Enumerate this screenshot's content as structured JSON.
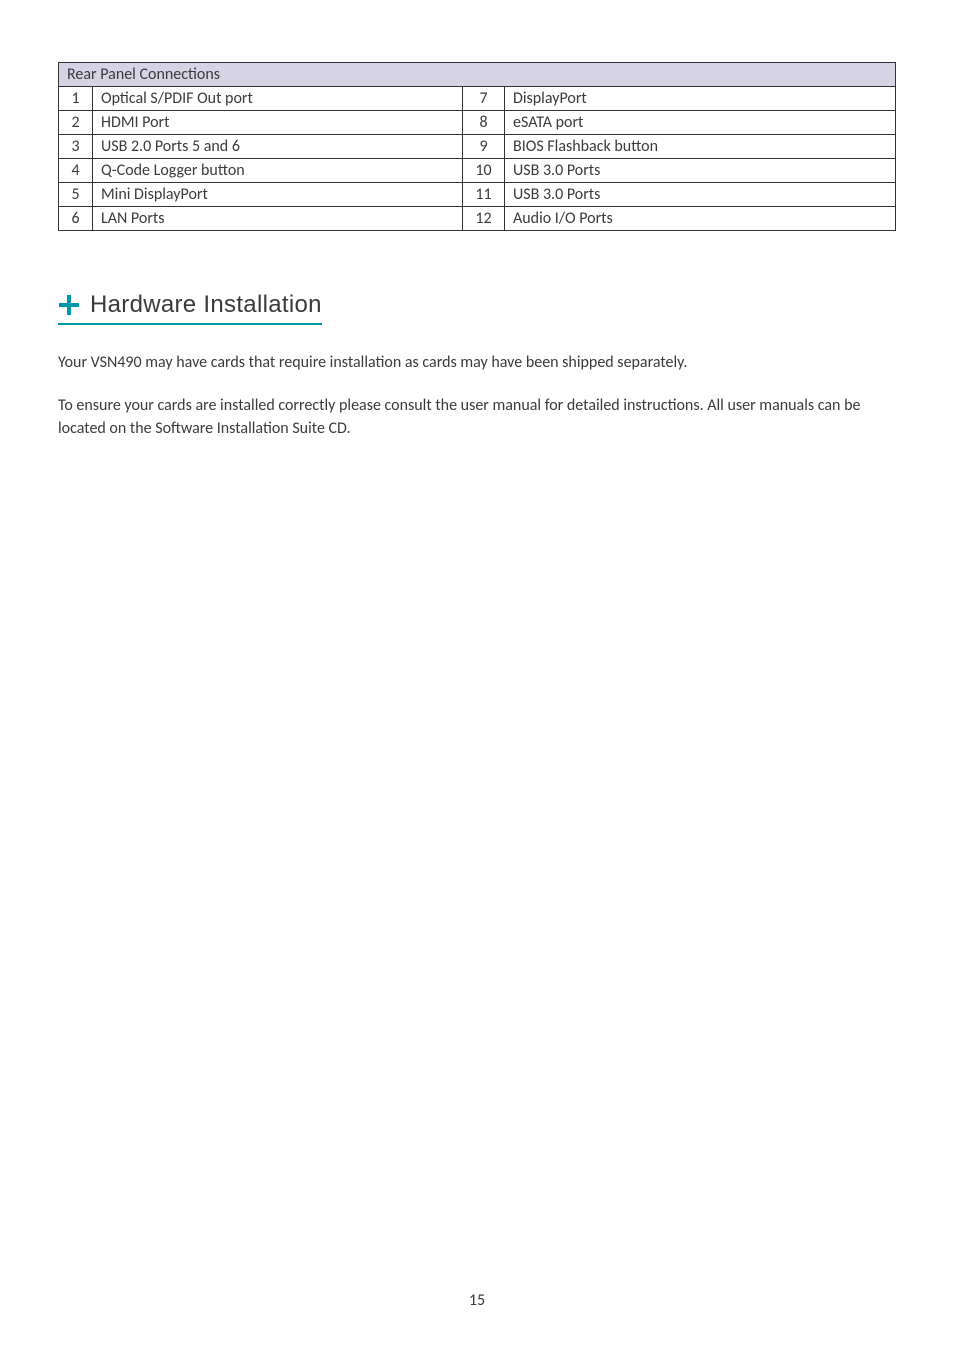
{
  "table": {
    "header": "Rear Panel Connections",
    "rows": [
      {
        "n1": "1",
        "d1": "Optical S/PDIF Out port",
        "n2": "7",
        "d2": "DisplayPort"
      },
      {
        "n1": "2",
        "d1": "HDMI Port",
        "n2": "8",
        "d2": "eSATA port"
      },
      {
        "n1": "3",
        "d1": "USB 2.0 Ports 5 and 6",
        "n2": "9",
        "d2": "BIOS Flashback button"
      },
      {
        "n1": "4",
        "d1": "Q-Code Logger button",
        "n2": "10",
        "d2": "USB 3.0 Ports"
      },
      {
        "n1": "5",
        "d1": "Mini DisplayPort",
        "n2": "11",
        "d2": "USB 3.0 Ports"
      },
      {
        "n1": "6",
        "d1": "LAN Ports",
        "n2": "12",
        "d2": "Audio I/O Ports"
      }
    ]
  },
  "heading": "Hardware Installation",
  "para1": "Your VSN490 may have cards that require installation as cards may have been shipped separately.",
  "para2": "To ensure your cards are installed correctly please consult the user manual for detailed instructions.  All user manuals can be located on the Software Installation Suite CD.",
  "pageNumber": "15"
}
